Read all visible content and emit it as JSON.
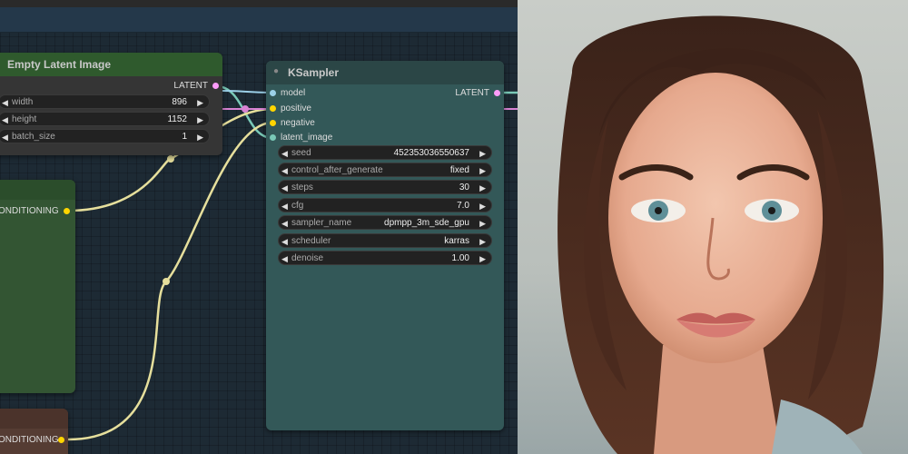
{
  "nodes": {
    "empty_latent": {
      "title": "Empty Latent Image",
      "output_label": "LATENT",
      "widgets": [
        {
          "label": "width",
          "value": "896"
        },
        {
          "label": "height",
          "value": "1152"
        },
        {
          "label": "batch_size",
          "value": "1"
        }
      ]
    },
    "conditioning_green": {
      "output_label": "ONDITIONING"
    },
    "conditioning_brown": {
      "output_label": "ONDITIONING"
    },
    "ksampler": {
      "title": "KSampler",
      "inputs": [
        "model",
        "positive",
        "negative",
        "latent_image"
      ],
      "output_label": "LATENT",
      "widgets": [
        {
          "label": "seed",
          "value": "452353036550637"
        },
        {
          "label": "control_after_generate",
          "value": "fixed"
        },
        {
          "label": "steps",
          "value": "30"
        },
        {
          "label": "cfg",
          "value": "7.0"
        },
        {
          "label": "sampler_name",
          "value": "dpmpp_3m_sde_gpu"
        },
        {
          "label": "scheduler",
          "value": "karras"
        },
        {
          "label": "denoise",
          "value": "1.00"
        }
      ]
    }
  },
  "colors": {
    "latent": "#ff9cf9",
    "model": "#b39ddb",
    "conditioning": "#ffd500",
    "latent_wire": "#e8b4e0",
    "cond_wire": "#e8e09a"
  },
  "icons": {
    "left_arrow": "◀",
    "right_arrow": "▶",
    "node_state": "●"
  }
}
